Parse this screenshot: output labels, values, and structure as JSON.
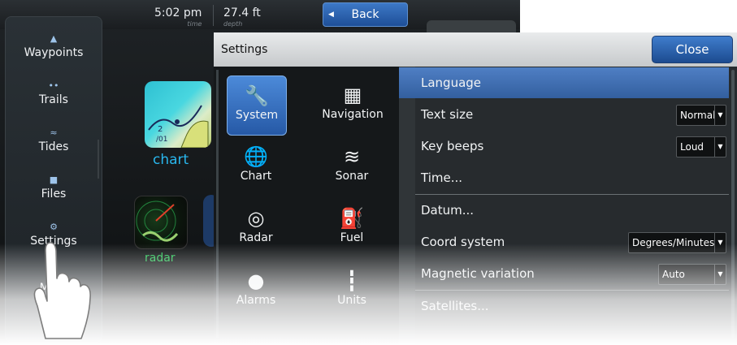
{
  "status": {
    "time": "5:02 pm",
    "time_caption": "time",
    "depth": "27.4 ft",
    "depth_caption": "depth"
  },
  "back_label": "Back",
  "sidebar": {
    "items": [
      {
        "label": "Waypoints",
        "icon": "waypoint-icon"
      },
      {
        "label": "Trails",
        "icon": "trail-icon"
      },
      {
        "label": "Tides",
        "icon": "tide-icon"
      },
      {
        "label": "Files",
        "icon": "folder-icon"
      },
      {
        "label": "Settings",
        "icon": "wrench-icon"
      },
      {
        "label": "More",
        "icon": "more-icon"
      }
    ]
  },
  "apps": {
    "chart": "chart",
    "radar": "radar"
  },
  "dialog": {
    "title": "Settings",
    "close_label": "Close",
    "categories": [
      {
        "label": "System",
        "icon": "wrench-icon",
        "selected": true
      },
      {
        "label": "Navigation",
        "icon": "navigation-calculator-icon"
      },
      {
        "label": "Chart",
        "icon": "globe-icon"
      },
      {
        "label": "Sonar",
        "icon": "sonar-icon"
      },
      {
        "label": "Radar",
        "icon": "radar-icon"
      },
      {
        "label": "Fuel",
        "icon": "fuel-pump-icon"
      },
      {
        "label": "Alarms",
        "icon": "alarm-bell-icon"
      },
      {
        "label": "Units",
        "icon": "ruler-icon"
      }
    ],
    "options": [
      {
        "label": "Language",
        "selected": true
      },
      {
        "label": "Text size",
        "value": "Normal"
      },
      {
        "label": "Key beeps",
        "value": "Loud"
      },
      {
        "label": "Time..."
      },
      {
        "label": "Datum..."
      },
      {
        "label": "Coord system",
        "value": "Degrees/Minutes"
      },
      {
        "label": "Magnetic variation",
        "value": "Auto"
      },
      {
        "label": "Satellites..."
      }
    ]
  },
  "colors": {
    "accent_blue": "#2659a6",
    "selection_blue": "#4f7fc4",
    "chart_label": "#29b7ee",
    "radar_label": "#2ec45a"
  }
}
